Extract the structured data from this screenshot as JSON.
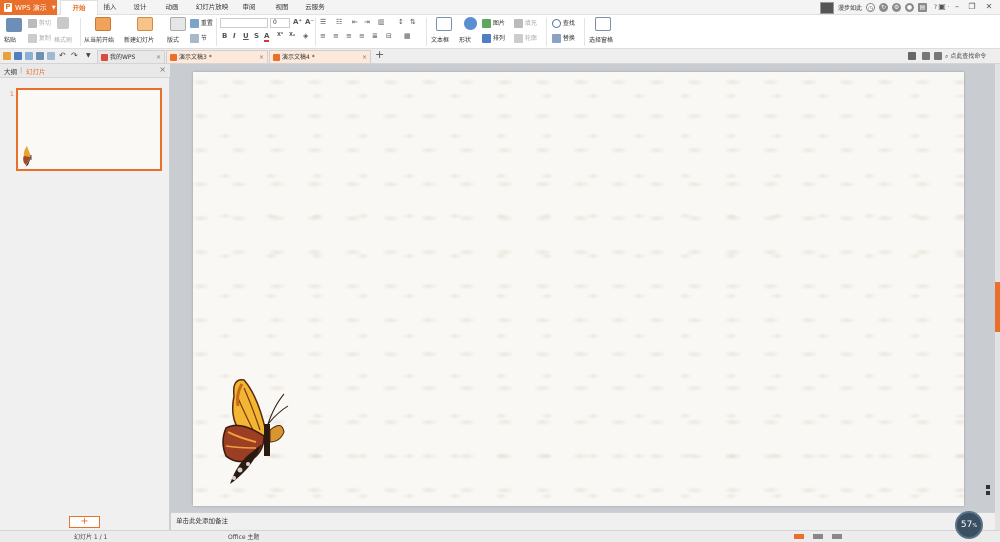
{
  "app": {
    "title": "WPS 演示"
  },
  "menu_tabs": [
    "开始",
    "插入",
    "设计",
    "动画",
    "幻灯片放映",
    "审阅",
    "视图",
    "云服务"
  ],
  "user": {
    "name": "漫步如此"
  },
  "ribbon": {
    "paste": "粘贴",
    "cut": "剪切",
    "copy": "复制",
    "format_painter": "格式刷",
    "from_current": "从当前开始",
    "new_slide": "新建幻灯片",
    "layout": "版式",
    "reset": "重置",
    "section": "节",
    "font_size": "0",
    "text_box": "文本框",
    "shape": "形状",
    "picture": "图片",
    "arrange": "排列",
    "fill": "填充",
    "outline": "轮廓",
    "find": "查找",
    "replace": "替换",
    "select_pane": "选择窗格"
  },
  "doc_tabs": [
    {
      "label": "我的WPS"
    },
    {
      "label": "演示文稿3 *"
    },
    {
      "label": "演示文稿4 *"
    }
  ],
  "search_cmd": "点此查找命令",
  "left_pane": {
    "tab_outline": "大纲",
    "tab_slides": "幻灯片",
    "slide_number": "1"
  },
  "notes_placeholder": "单击此处添加备注",
  "status": {
    "slide_info": "幻灯片 1 / 1",
    "theme": "Office 主题",
    "zoom": "57",
    "zoom_unit": "%"
  },
  "colors": {
    "accent": "#ea6f2b",
    "slide_bg": "#faf8f4"
  }
}
